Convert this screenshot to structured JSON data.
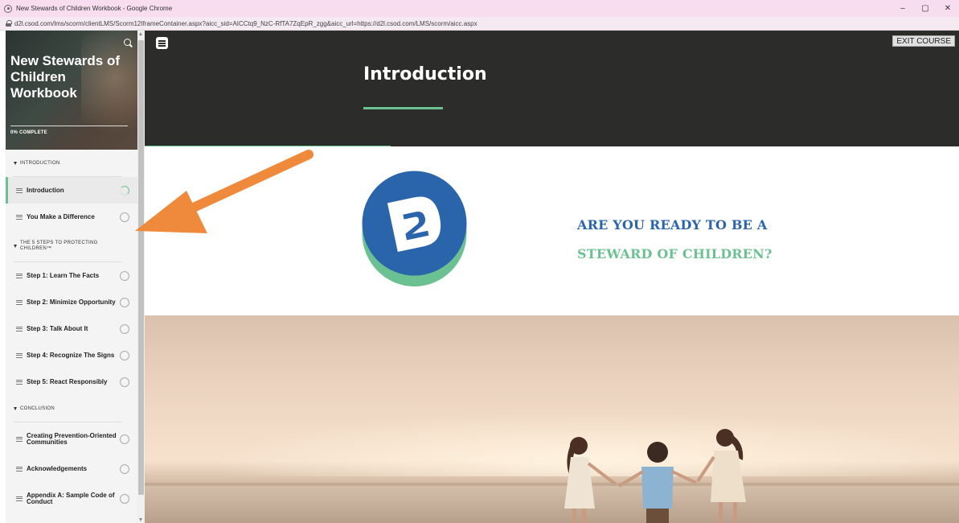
{
  "browser": {
    "window_title": "New Stewards of Children Workbook - Google Chrome",
    "url": "d2l.csod.com/lms/scorm/clientLMS/Scorm12IframeContainer.aspx?aicc_sid=AICCtq9_NzC-RfTA7ZqEpR_zgg&aicc_url=https://d2l.csod.com/LMS/scorm/aicc.aspx",
    "minimize_glyph": "–",
    "restore_glyph": "▢",
    "close_glyph": "✕"
  },
  "sidebar": {
    "course_title": "New Stewards of Children Workbook",
    "progress_label": "0% COMPLETE",
    "sections": [
      {
        "title": "INTRODUCTION",
        "lessons": [
          {
            "label": "Introduction",
            "status": "in-progress"
          },
          {
            "label": "You Make a Difference",
            "status": "not-started"
          }
        ]
      },
      {
        "title": "THE 5 STEPS TO PROTECTING CHILDREN™",
        "lessons": [
          {
            "label": "Step 1: Learn The Facts",
            "status": "not-started"
          },
          {
            "label": "Step 2: Minimize Opportunity",
            "status": "not-started"
          },
          {
            "label": "Step 3: Talk About It",
            "status": "not-started"
          },
          {
            "label": "Step 4: Recognize The Signs",
            "status": "not-started"
          },
          {
            "label": "Step 5: React Responsibly",
            "status": "not-started"
          }
        ]
      },
      {
        "title": "CONCLUSION",
        "lessons": [
          {
            "label": "Creating Prevention-Oriented Communities",
            "status": "not-started"
          },
          {
            "label": "Acknowledgements",
            "status": "not-started"
          },
          {
            "label": "Appendix A: Sample Code of Conduct",
            "status": "not-started"
          }
        ]
      }
    ]
  },
  "main": {
    "exit_label": "EXIT COURSE",
    "lesson_title": "Introduction",
    "tagline_line1": "ARE YOU READY TO BE A",
    "tagline_line2": "STEWARD OF CHILDREN?"
  },
  "colors": {
    "accent_green": "#6cc192",
    "brand_blue": "#2a65ac",
    "hero_bg": "#2c2d2b"
  }
}
